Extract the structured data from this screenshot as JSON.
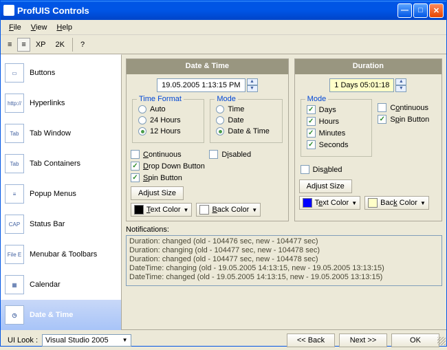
{
  "window": {
    "title": "ProfUIS Controls"
  },
  "menu": {
    "file": "File",
    "view": "View",
    "help": "Help"
  },
  "toolbar": {
    "xp": "XP",
    "twok": "2K"
  },
  "sidebar": {
    "items": [
      {
        "label": "Buttons",
        "icon": "btn"
      },
      {
        "label": "Hyperlinks",
        "icon": "http://"
      },
      {
        "label": "Tab Window",
        "icon": "Tab"
      },
      {
        "label": "Tab Containers",
        "icon": "Tab"
      },
      {
        "label": "Popup Menus",
        "icon": "≡"
      },
      {
        "label": "Status Bar",
        "icon": "CAP"
      },
      {
        "label": "Menubar & Toolbars",
        "icon": "File E"
      },
      {
        "label": "Calendar",
        "icon": "▦"
      },
      {
        "label": "Date & Time",
        "icon": "◷"
      }
    ]
  },
  "datetime": {
    "title": "Date & Time",
    "value": "19.05.2005 1:13:15 PM",
    "time_format": {
      "legend": "Time Format",
      "auto": "Auto",
      "h24": "24 Hours",
      "h12": "12 Hours"
    },
    "mode": {
      "legend": "Mode",
      "time": "Time",
      "date": "Date",
      "datetime": "Date & Time"
    },
    "continuous": "Continuous",
    "disabled": "Disabled",
    "dropdown": "Drop Down Button",
    "spin": "Spin Button",
    "adjust": "Adjust Size",
    "textcolor": "Text Color",
    "backcolor": "Back Color",
    "textcolor_swatch": "#000000",
    "backcolor_swatch": "#ffffff"
  },
  "duration": {
    "title": "Duration",
    "value": "1 Days 05:01:18",
    "mode": {
      "legend": "Mode",
      "days": "Days",
      "hours": "Hours",
      "minutes": "Minutes",
      "seconds": "Seconds"
    },
    "continuous": "Continuous",
    "spin": "Spin Button",
    "disabled": "Disabled",
    "adjust": "Adjust Size",
    "textcolor": "Text Color",
    "backcolor": "Back Color",
    "textcolor_swatch": "#0000ff",
    "backcolor_swatch": "#ffffc8"
  },
  "notif": {
    "label": "Notifications:",
    "lines": [
      "Duration: changed (old - 104476 sec, new - 104477 sec)",
      "Duration: changing (old - 104477 sec, new - 104478 sec)",
      "Duration: changed (old - 104477 sec, new - 104478 sec)",
      "DateTime: changing (old - 19.05.2005 14:13:15, new - 19.05.2005 13:13:15)",
      "DateTime: changed (old - 19.05.2005 14:13:15, new - 19.05.2005 13:13:15)"
    ]
  },
  "footer": {
    "uilook_label": "UI Look :",
    "uilook_value": "Visual Studio 2005",
    "back": "<< Back",
    "next": "Next >>",
    "ok": "OK"
  }
}
